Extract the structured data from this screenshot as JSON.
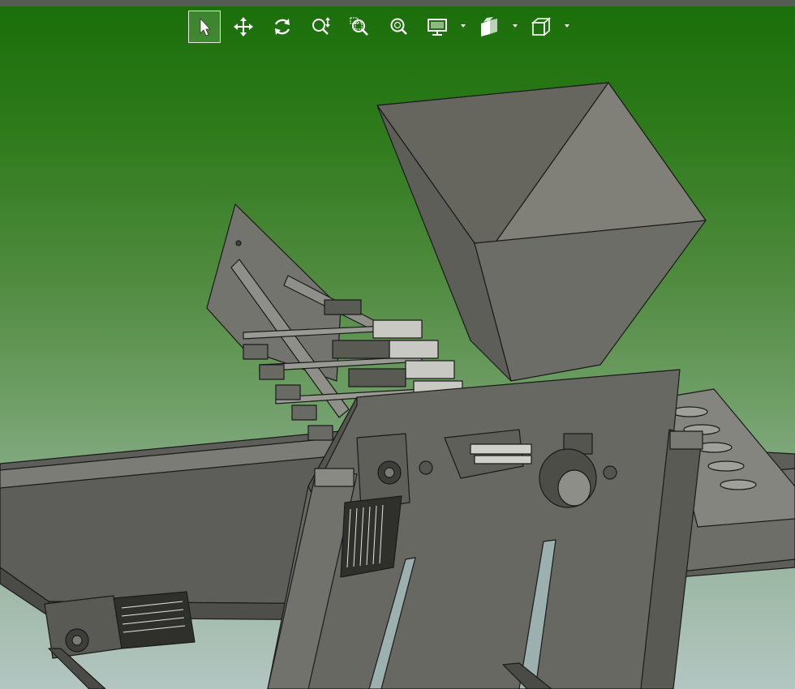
{
  "app": {
    "viewport": "cad-3d-viewport",
    "background_top": "#1a6e0a",
    "background_bottom": "#b3c6c2"
  },
  "toolbar": {
    "tools": [
      {
        "id": "select",
        "icon": "select-arrow-icon",
        "active": true
      },
      {
        "id": "pan",
        "icon": "pan-move-icon"
      },
      {
        "id": "rotate",
        "icon": "rotate-icon"
      },
      {
        "id": "zoom",
        "icon": "zoom-updown-icon"
      },
      {
        "id": "zoom-window",
        "icon": "zoom-window-icon"
      },
      {
        "id": "zoom-fit",
        "icon": "zoom-fit-icon"
      },
      {
        "id": "display-mode",
        "icon": "monitor-icon",
        "dropdown": true
      },
      {
        "id": "view-orientation",
        "icon": "standard-views-icon",
        "dropdown": true
      },
      {
        "id": "render-style",
        "icon": "cube-icon",
        "dropdown": true
      }
    ]
  },
  "model": {
    "part_color": "#6b6b66",
    "edge_color": "#1a1a1a"
  }
}
